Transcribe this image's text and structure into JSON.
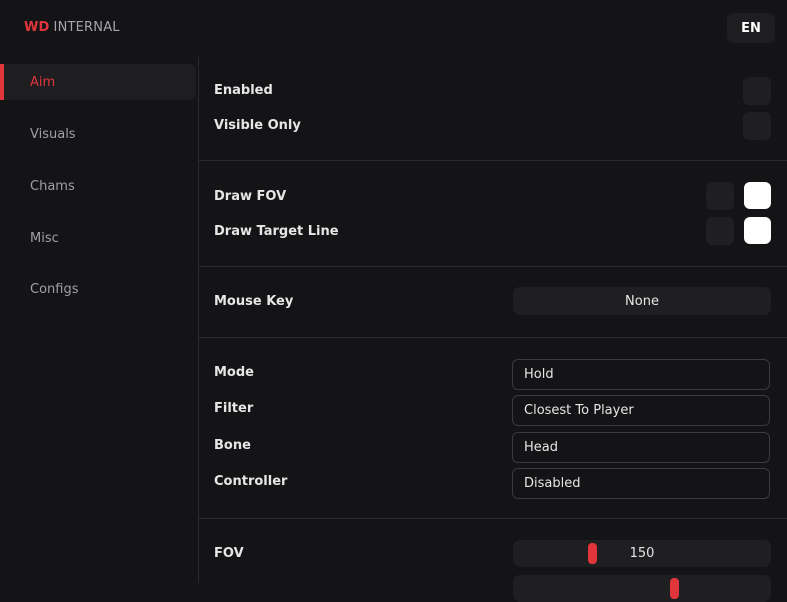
{
  "header": {
    "brand_primary": "WD",
    "brand_secondary": "INTERNAL",
    "language": "EN"
  },
  "sidebar": {
    "items": [
      {
        "label": "Aim",
        "active": true
      },
      {
        "label": "Visuals",
        "active": false
      },
      {
        "label": "Chams",
        "active": false
      },
      {
        "label": "Misc",
        "active": false
      },
      {
        "label": "Configs",
        "active": false
      }
    ]
  },
  "aim": {
    "enabled": {
      "label": "Enabled",
      "checked": false
    },
    "visible_only": {
      "label": "Visible Only",
      "checked": false
    },
    "draw_fov": {
      "label": "Draw FOV",
      "checked": false,
      "color": "#ffffff"
    },
    "draw_target_line": {
      "label": "Draw Target Line",
      "checked": false,
      "color": "#ffffff"
    },
    "mouse_key": {
      "label": "Mouse Key",
      "value": "None"
    },
    "mode": {
      "label": "Mode",
      "value": "Hold"
    },
    "filter": {
      "label": "Filter",
      "value": "Closest To Player"
    },
    "bone": {
      "label": "Bone",
      "value": "Head"
    },
    "controller": {
      "label": "Controller",
      "value": "Disabled"
    },
    "fov": {
      "label": "FOV",
      "value": "150",
      "fraction": 0.3
    },
    "next_slider": {
      "fraction": 0.63
    }
  },
  "colors": {
    "accent": "#e0353b",
    "background": "#141416",
    "control": "#1f1f22"
  }
}
